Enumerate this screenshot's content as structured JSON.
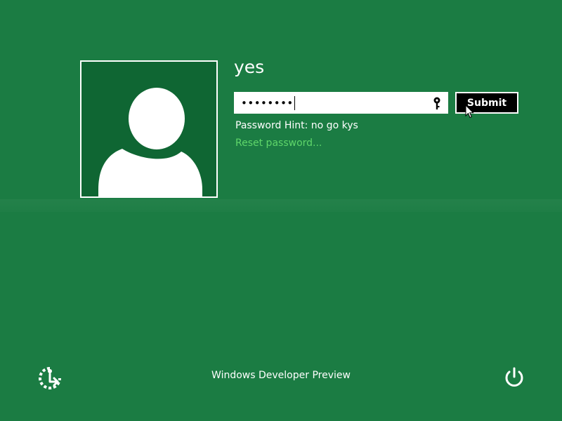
{
  "user": {
    "name": "yes",
    "avatar_icon": "user-silhouette-icon"
  },
  "login": {
    "password_value": "••••••••",
    "reveal_icon": "password-reveal-icon",
    "submit_label": "Submit",
    "hint_text": "Password Hint: no go kys",
    "reset_link": "Reset password..."
  },
  "footer": {
    "ease_of_access_icon": "ease-of-access-icon",
    "product_name": "Windows Developer Preview",
    "power_icon": "power-icon"
  },
  "colors": {
    "background": "#1b7c43",
    "avatar_background": "#0f6633",
    "link": "#5fd66a",
    "button": "#000000"
  }
}
